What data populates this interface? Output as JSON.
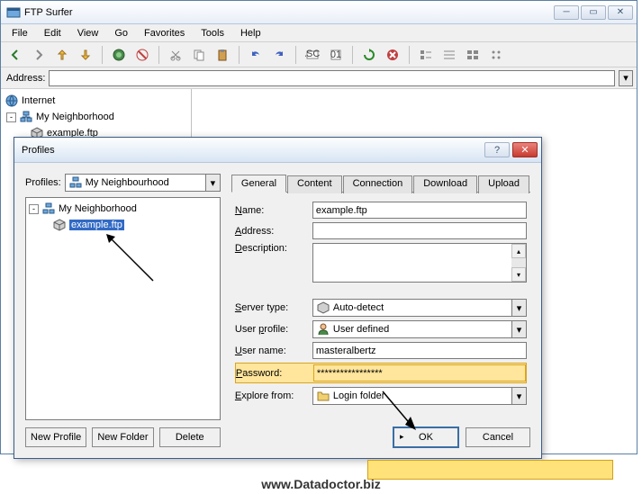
{
  "window": {
    "title": "FTP Surfer"
  },
  "menu": {
    "file": "File",
    "edit": "Edit",
    "view": "View",
    "go": "Go",
    "favorites": "Favorites",
    "tools": "Tools",
    "help": "Help"
  },
  "address_bar": {
    "label": "Address:",
    "value": ""
  },
  "main_tree": {
    "root": "Internet",
    "neighborhood": "My Neighborhood",
    "example": "example.ftp"
  },
  "dialog": {
    "title": "Profiles",
    "profiles_label": "Profiles:",
    "profiles_combo": "My Neighbourhood",
    "tree": {
      "root": "My Neighborhood",
      "selected": "example.ftp"
    },
    "buttons": {
      "new_profile": "New Profile",
      "new_folder": "New Folder",
      "delete": "Delete"
    },
    "tabs": {
      "general": "General",
      "content": "Content",
      "connection": "Connection",
      "download": "Download",
      "upload": "Upload"
    },
    "form": {
      "name_label": "Name:",
      "name_value": "example.ftp",
      "address_label": "Address:",
      "address_value": "",
      "description_label": "Description:",
      "description_value": "",
      "server_type_label": "Server type:",
      "server_type_value": "Auto-detect",
      "user_profile_label": "User profile:",
      "user_profile_value": "User defined",
      "user_name_label": "User name:",
      "user_name_value": "masteralbertz",
      "password_label": "Password:",
      "password_value": "*****************",
      "explore_label": "Explore from:",
      "explore_value": "Login folder"
    },
    "bottom": {
      "ok": "OK",
      "cancel": "Cancel"
    }
  },
  "footer": "www.Datadoctor.biz"
}
